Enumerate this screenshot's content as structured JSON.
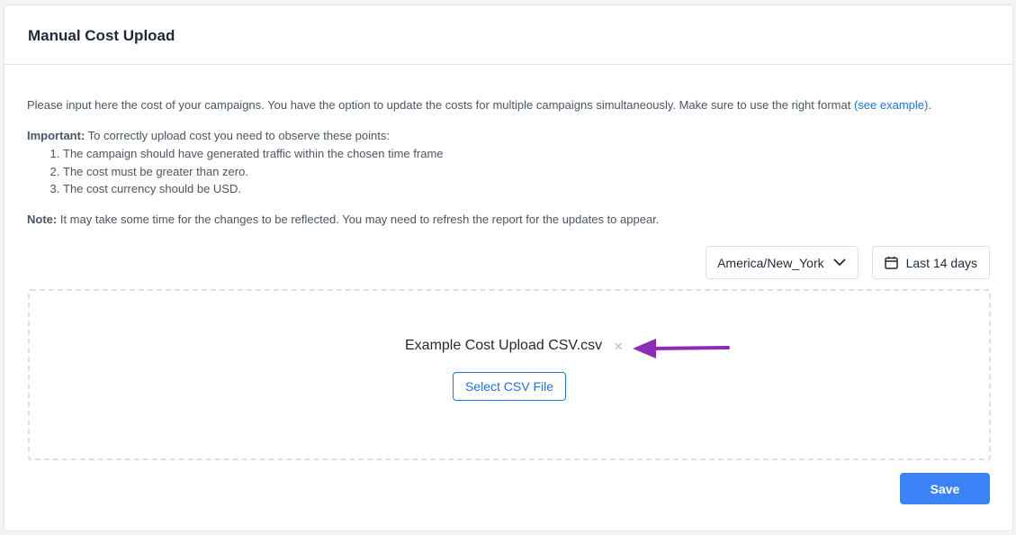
{
  "header": {
    "title": "Manual Cost Upload"
  },
  "intro": {
    "text": "Please input here the cost of your campaigns. You have the option to update the costs for multiple campaigns simultaneously. Make sure to use the right format ",
    "link": "(see example)",
    "end": "."
  },
  "important": {
    "label": "Important:",
    "text": " To correctly upload cost you need to observe these points:",
    "points": [
      "The campaign should have generated traffic within the chosen time frame",
      "The cost must be greater than zero.",
      "The cost currency should be USD."
    ]
  },
  "note": {
    "label": "Note:",
    "text": " It may take some time for the changes to be reflected. You may need to refresh the report for the updates to appear."
  },
  "controls": {
    "timezone": "America/New_York",
    "date_range": "Last 14 days"
  },
  "upload": {
    "file_name": "Example Cost Upload CSV.csv",
    "remove_glyph": "×",
    "select_label": "Select CSV File"
  },
  "actions": {
    "save_label": "Save"
  },
  "colors": {
    "link": "#1a73e8",
    "primary_button": "#3b82f6",
    "annotation_arrow": "#8e2bb6"
  },
  "icons": {
    "timezone": "chevron-down-icon",
    "date": "calendar-icon",
    "remove": "close-icon",
    "annotation": "arrow-left-icon"
  }
}
